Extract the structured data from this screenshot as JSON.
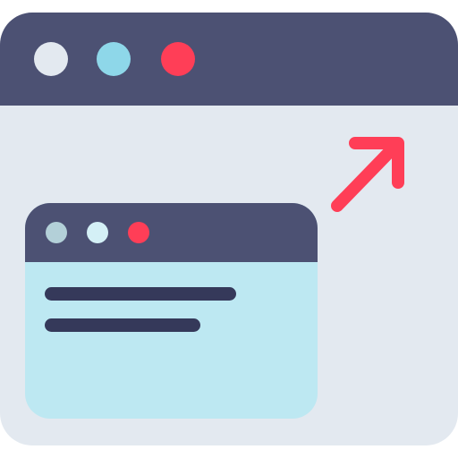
{
  "colors": {
    "frame": "#4c5173",
    "page_background": "#e3e9f0",
    "mini_content": "#bde8f2",
    "text_lines": "#35395a",
    "accent": "#ff3e57"
  },
  "browser_window": {
    "buttons": [
      {
        "icon": "circle-icon",
        "color": "#e3e9f0"
      },
      {
        "icon": "circle-icon",
        "color": "#8ed7e9"
      },
      {
        "icon": "circle-icon",
        "color": "#ff3e57"
      }
    ]
  },
  "mini_window": {
    "buttons": [
      {
        "icon": "circle-icon",
        "color": "#b3d0d8"
      },
      {
        "icon": "circle-icon",
        "color": "#d4f0f6"
      },
      {
        "icon": "circle-icon",
        "color": "#ff3e57"
      }
    ],
    "content_lines": 2
  },
  "expand_indicator": {
    "icon": "arrow-up-right-icon",
    "color": "#ff3e57"
  }
}
